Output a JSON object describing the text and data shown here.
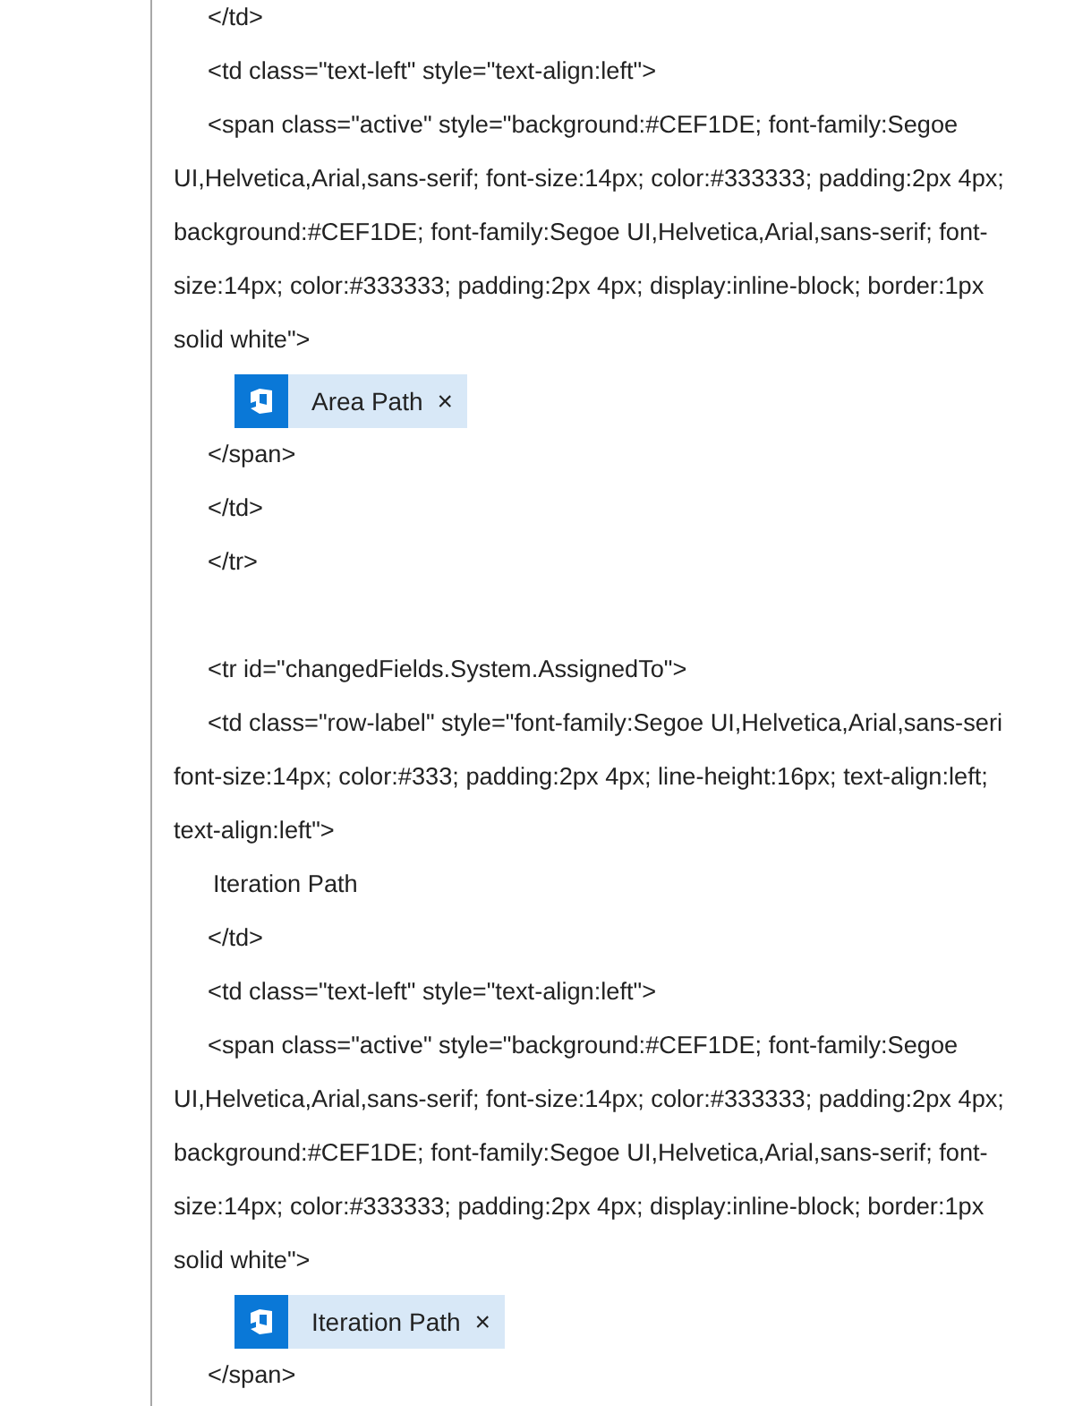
{
  "blocks": [
    {
      "kind": "code",
      "lines": [
        "</td>"
      ]
    },
    {
      "kind": "code",
      "lines": [
        "<td class=\"text-left\" style=\"text-align:left\">"
      ]
    },
    {
      "kind": "code",
      "lines": [
        "<span class=\"active\" style=\"background:#CEF1DE; font-family:Segoe",
        "UI,Helvetica,Arial,sans-serif; font-size:14px; color:#333333; padding:2px 4px;",
        "background:#CEF1DE; font-family:Segoe UI,Helvetica,Arial,sans-serif; font-",
        "size:14px; color:#333333; padding:2px 4px; display:inline-block; border:1px",
        "solid white\">"
      ]
    },
    {
      "kind": "chip",
      "label": "Area Path",
      "close": "×"
    },
    {
      "kind": "code",
      "lines": [
        "</span>"
      ]
    },
    {
      "kind": "code",
      "lines": [
        "</td>"
      ]
    },
    {
      "kind": "code",
      "lines": [
        "</tr>"
      ]
    },
    {
      "kind": "blank"
    },
    {
      "kind": "code",
      "lines": [
        "<tr id=\"changedFields.System.AssignedTo\">"
      ]
    },
    {
      "kind": "code",
      "lines": [
        "<td class=\"row-label\" style=\"font-family:Segoe UI,Helvetica,Arial,sans-seri",
        "font-size:14px; color:#333; padding:2px 4px; line-height:16px; text-align:left;",
        "text-align:left\">"
      ]
    },
    {
      "kind": "text",
      "text": "Iteration Path"
    },
    {
      "kind": "code",
      "lines": [
        "</td>"
      ]
    },
    {
      "kind": "code",
      "lines": [
        "<td class=\"text-left\" style=\"text-align:left\">"
      ]
    },
    {
      "kind": "code",
      "lines": [
        "<span class=\"active\" style=\"background:#CEF1DE; font-family:Segoe",
        "UI,Helvetica,Arial,sans-serif; font-size:14px; color:#333333; padding:2px 4px;",
        "background:#CEF1DE; font-family:Segoe UI,Helvetica,Arial,sans-serif; font-",
        "size:14px; color:#333333; padding:2px 4px; display:inline-block; border:1px",
        "solid white\">"
      ]
    },
    {
      "kind": "chip",
      "label": "Iteration Path",
      "close": "×"
    },
    {
      "kind": "code",
      "lines": [
        "</span>"
      ]
    }
  ]
}
